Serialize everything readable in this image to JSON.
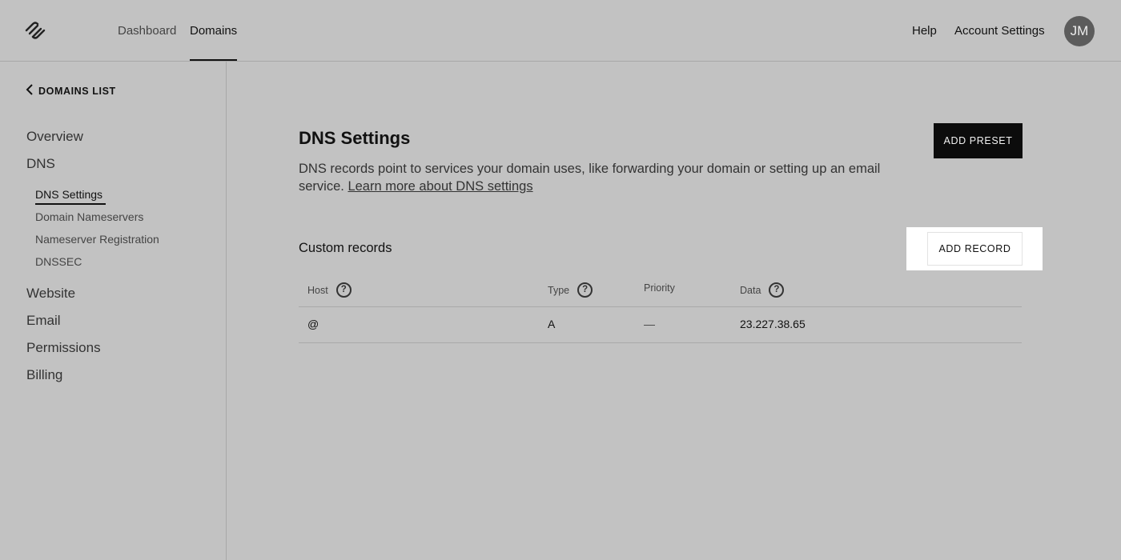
{
  "topnav": {
    "links": [
      "Dashboard",
      "Domains"
    ],
    "active": "Domains",
    "right_links": [
      "Help",
      "Account Settings"
    ],
    "avatar_initials": "JM"
  },
  "sidebar": {
    "back_label": "DOMAINS LIST",
    "sections": [
      "Overview",
      "DNS"
    ],
    "dns_items": [
      "DNS Settings",
      "Domain Nameservers",
      "Nameserver Registration",
      "DNSSEC"
    ],
    "more_sections": [
      "Website",
      "Email",
      "Permissions",
      "Billing"
    ]
  },
  "main": {
    "title": "DNS Settings",
    "description": "DNS records point to services your domain uses, like forwarding your domain or setting up an email service.",
    "learn_more": "Learn more about DNS settings",
    "add_preset_label": "ADD PRESET",
    "custom_records_title": "Custom records",
    "add_record_label": "ADD RECORD",
    "table": {
      "headers": [
        "Host",
        "Type",
        "Priority",
        "Data"
      ],
      "rows": [
        [
          "@",
          "A",
          "—",
          "23.227.38.65"
        ]
      ]
    }
  },
  "colors": {
    "background": "#c2c2c2",
    "primary_button": "#0c0c0c",
    "highlight": "#ffffff"
  }
}
